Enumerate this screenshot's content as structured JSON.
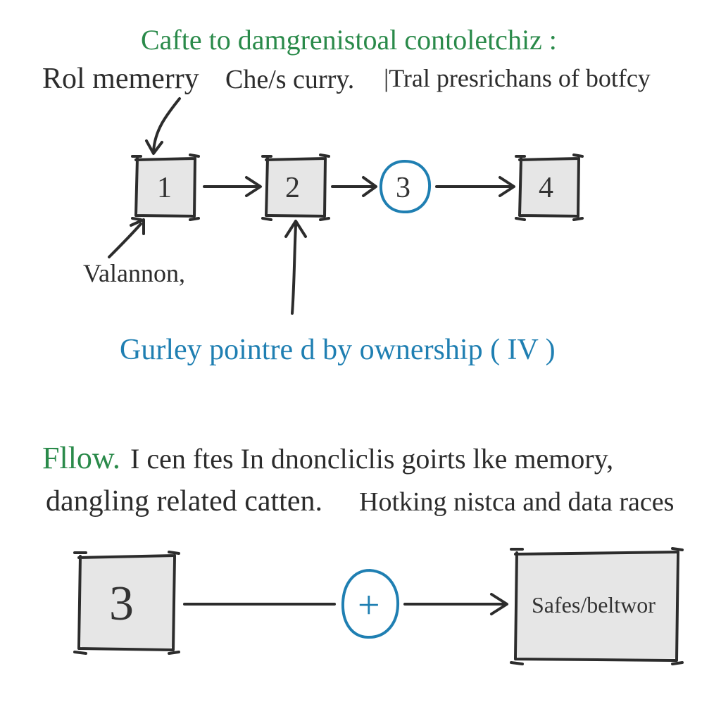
{
  "title_green": "Cafte  to  damgrenistoal  contoletchiz :",
  "line1a_black": "Rol  memerry",
  "line1b_black": "Che/s  curry.",
  "line1c_black": "|Tral  presrichans  of  botfcy",
  "valannon": "Valannon,",
  "ownership_blue": "Gurley  pointre d  by  ownership  ( IV )",
  "flow_green": "Fllow.",
  "para2a_black": "I  cen  ftes  In  dnoncliclis  goirts  lke  memory,",
  "para2b_black": "dangling  related  catten.",
  "para2c_black": "Hotking  nistca  and  data  races",
  "node1": "1",
  "node2": "2",
  "node3": "3",
  "node4": "4",
  "bignode3": "3",
  "plus": "+",
  "safes": "Safes/beltwor"
}
